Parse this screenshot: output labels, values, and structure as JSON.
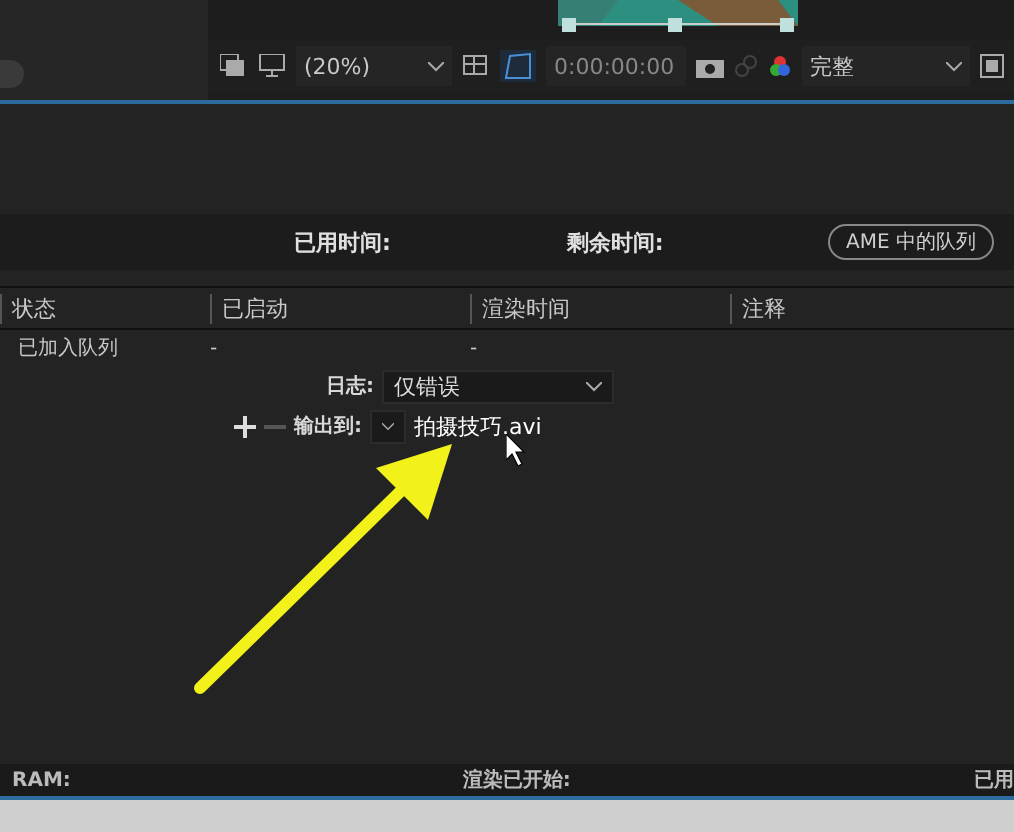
{
  "viewer": {
    "zoom": "(20%)",
    "timecode": "0:00:00:00",
    "resolution": "完整"
  },
  "queue_header": {
    "elapsed_label": "已用时间:",
    "remaining_label": "剩余时间:",
    "ame_button": "AME 中的队列"
  },
  "table": {
    "columns": [
      "状态",
      "已启动",
      "渲染时间",
      "注释"
    ],
    "rows": [
      {
        "status": "已加入队列",
        "started": "-",
        "render_time": "-"
      }
    ]
  },
  "log": {
    "label": "日志:",
    "value": "仅错误"
  },
  "output": {
    "label": "输出到:",
    "file": "拍摄技巧.avi"
  },
  "status_bar": {
    "ram": "RAM:",
    "render_started": "渲染已开始:",
    "elapsed": "已用"
  }
}
